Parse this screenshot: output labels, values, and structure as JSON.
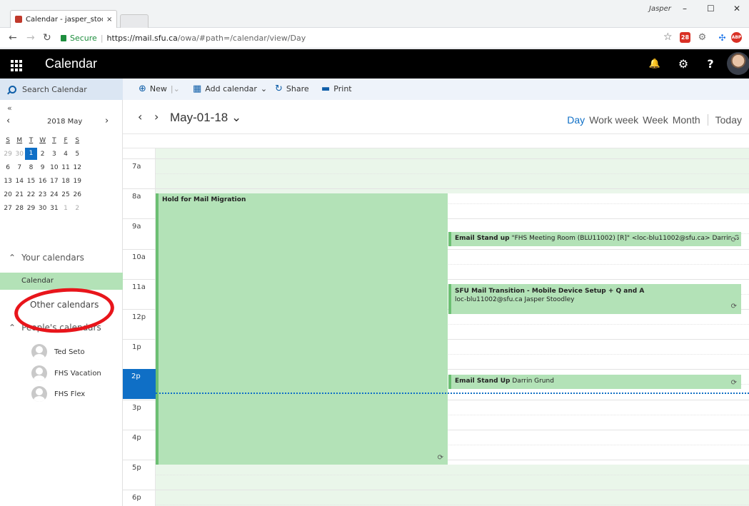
{
  "browser": {
    "tab_title": "Calendar - jasper_stoodle",
    "tab_close": "×",
    "profile_name": "Jasper",
    "min": "–",
    "max": "☐",
    "close": "✕",
    "secure_label": "Secure",
    "url_host": "https://mail.sfu.ca",
    "url_path": "/owa/#path=/calendar/view/Day",
    "ext_badge": "28",
    "abp": "ABP"
  },
  "header": {
    "app_title": "Calendar",
    "bell": "🔔",
    "settings": "⚙",
    "help": "?"
  },
  "command_bar": {
    "search_placeholder": "Search Calendar",
    "new_label": "New",
    "add_calendar_label": "Add calendar",
    "share_label": "Share",
    "print_label": "Print"
  },
  "mini_calendar": {
    "collapse": "«",
    "month_title": "2018 May",
    "days_of_week": [
      "S",
      "M",
      "T",
      "W",
      "T",
      "F",
      "S"
    ],
    "weeks": [
      [
        "29",
        "30",
        "1",
        "2",
        "3",
        "4",
        "5"
      ],
      [
        "6",
        "7",
        "8",
        "9",
        "10",
        "11",
        "12"
      ],
      [
        "13",
        "14",
        "15",
        "16",
        "17",
        "18",
        "19"
      ],
      [
        "20",
        "21",
        "22",
        "23",
        "24",
        "25",
        "26"
      ],
      [
        "27",
        "28",
        "29",
        "30",
        "31",
        "1",
        "2"
      ]
    ]
  },
  "sidebar": {
    "your_calendars": "Your calendars",
    "calendar_item": "Calendar",
    "other_calendars": "Other calendars",
    "peoples_calendars": "People's calendars",
    "people": [
      "Ted Seto",
      "FHS Vacation",
      "FHS Flex"
    ]
  },
  "view": {
    "date_title": "May-01-18",
    "views": [
      "Day",
      "Work week",
      "Week",
      "Month"
    ],
    "active_view": "Day",
    "today": "Today"
  },
  "hours": [
    "7a",
    "8a",
    "9a",
    "10a",
    "11a",
    "12p",
    "1p",
    "2p",
    "3p",
    "4p",
    "5p",
    "6p"
  ],
  "current_hour": "2p",
  "events": [
    {
      "title": "Hold for Mail Migration",
      "detail": ""
    },
    {
      "title": "Email Stand up",
      "detail": "\"FHS Meeting Room (BLU11002) [R]\" <loc-blu11002@sfu.ca> Darrin G"
    },
    {
      "title": "SFU Mail Transition - Mobile Device Setup + Q and A",
      "detail": "loc-blu11002@sfu.ca Jasper Stoodley"
    },
    {
      "title": "Email Stand Up",
      "detail": "Darrin Grund"
    }
  ],
  "colors": {
    "accent": "#0f6fc6",
    "event_fill": "#b3e2b7",
    "event_border": "#6cbf73",
    "annotation": "#e8151b"
  }
}
